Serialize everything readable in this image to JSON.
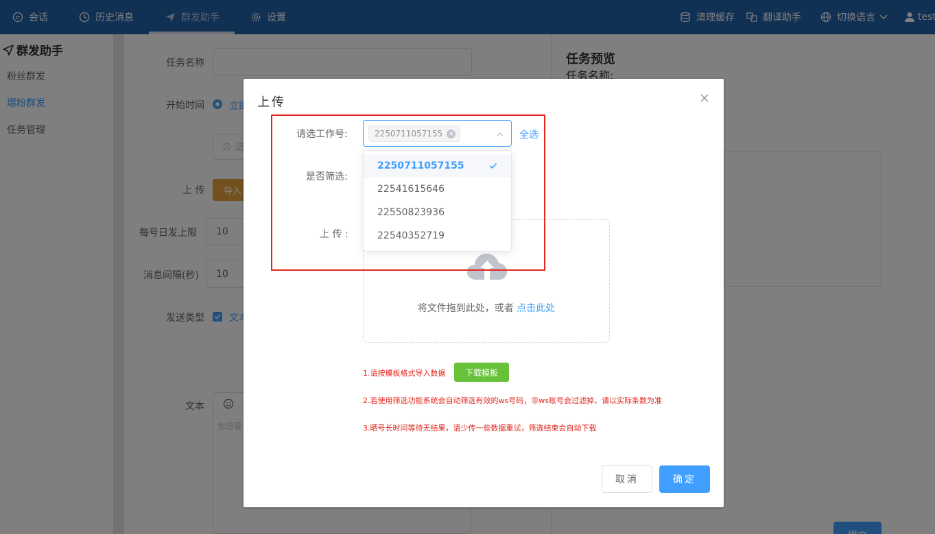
{
  "nav": {
    "items": [
      {
        "label": "会话",
        "icon": "chat-icon"
      },
      {
        "label": "历史消息",
        "icon": "clock-icon"
      },
      {
        "label": "群发助手",
        "icon": "send-icon"
      },
      {
        "label": "设置",
        "icon": "gear-icon"
      }
    ],
    "right": [
      {
        "label": "清理缓存",
        "icon": "database-icon"
      },
      {
        "label": "翻译助手",
        "icon": "translate-icon"
      },
      {
        "label": "切换语言",
        "icon": "globe-icon"
      },
      {
        "label": "test",
        "icon": "user-icon"
      }
    ]
  },
  "sidebar": {
    "title": "群发助手",
    "items": [
      {
        "label": "粉丝群发"
      },
      {
        "label": "爆粉群发"
      },
      {
        "label": "任务管理"
      }
    ]
  },
  "form": {
    "task_name_label": "任务名称",
    "start_time_label": "开始时间",
    "start_time_option": "立即",
    "date_placeholder": "选",
    "upload_label": "上 传",
    "import_button": "导入",
    "daily_limit_label": "每号日发上限",
    "daily_limit_value": "10",
    "interval_label": "消息间隔(秒)",
    "interval_value": "10",
    "send_type_label": "发送类型",
    "send_type_option": "文本",
    "text_label": "文本",
    "text_placeholder": "你想要"
  },
  "preview": {
    "title": "任务预览",
    "task_name_label": "任务名称:",
    "submit_button": "提交"
  },
  "dialog": {
    "title": "上传",
    "select_label": "请选工作号:",
    "selected_tag": "2250711057155",
    "select_all": "全选",
    "filter_label": "是否筛选:",
    "upload_label": "上 传 :",
    "options": [
      "2250711057155",
      "22541615646",
      "22550823936",
      "22540352719"
    ],
    "upload_text": "将文件拖到此处，或者 ",
    "upload_link": "点击此处",
    "note1": "1.请按模板格式导入数据",
    "download_button": "下载模板",
    "note2": "2.若使用筛选功能系统会自动筛选有效的ws号码，非ws账号会过滤掉，请以实际条数为准",
    "note3": "3.晒号长时间等待无结果，请少传一些数据重试，筛选结束会自动下载",
    "cancel_button": "取消",
    "confirm_button": "确定"
  },
  "colors": {
    "nav_bg": "#2160a8",
    "primary": "#409eff",
    "success": "#67c23a",
    "danger": "#e3261c",
    "import_btn": "#e6a23c"
  }
}
